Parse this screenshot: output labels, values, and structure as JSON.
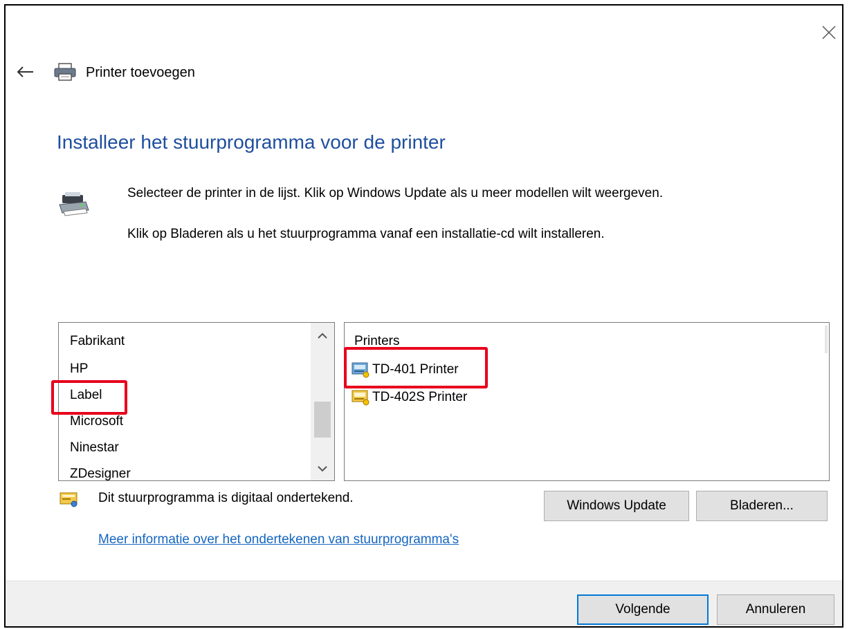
{
  "window": {
    "title": "Printer toevoegen",
    "heading": "Installeer het stuurprogramma voor de printer",
    "instruction_1": "Selecteer de printer in de lijst. Klik op Windows Update als u meer modellen wilt weergeven.",
    "instruction_2": "Klik op Bladeren als u het stuurprogramma vanaf een installatie-cd wilt installeren."
  },
  "manufacturer_list": {
    "header": "Fabrikant",
    "items": [
      "HP",
      "Label",
      "Microsoft",
      "Ninestar",
      "ZDesigner"
    ],
    "selected": "Label"
  },
  "printer_list": {
    "header": "Printers",
    "items": [
      "TD-401 Printer",
      "TD-402S Printer"
    ],
    "selected": "TD-401 Printer"
  },
  "signature": {
    "text": "Dit stuurprogramma is digitaal ondertekend.",
    "link": "Meer informatie over het ondertekenen van stuurprogramma's"
  },
  "buttons": {
    "windows_update": "Windows Update",
    "browse": "Bladeren...",
    "next": "Volgende",
    "cancel": "Annuleren"
  },
  "colors": {
    "heading": "#1e4e9e",
    "link": "#1566c0",
    "highlight": "#e8001c",
    "default_button_border": "#0078d7"
  },
  "icons": {
    "close": "close-icon",
    "back": "back-arrow-icon",
    "printer": "printer-icon",
    "driver": "driver-icon",
    "certificate": "certificate-icon"
  }
}
